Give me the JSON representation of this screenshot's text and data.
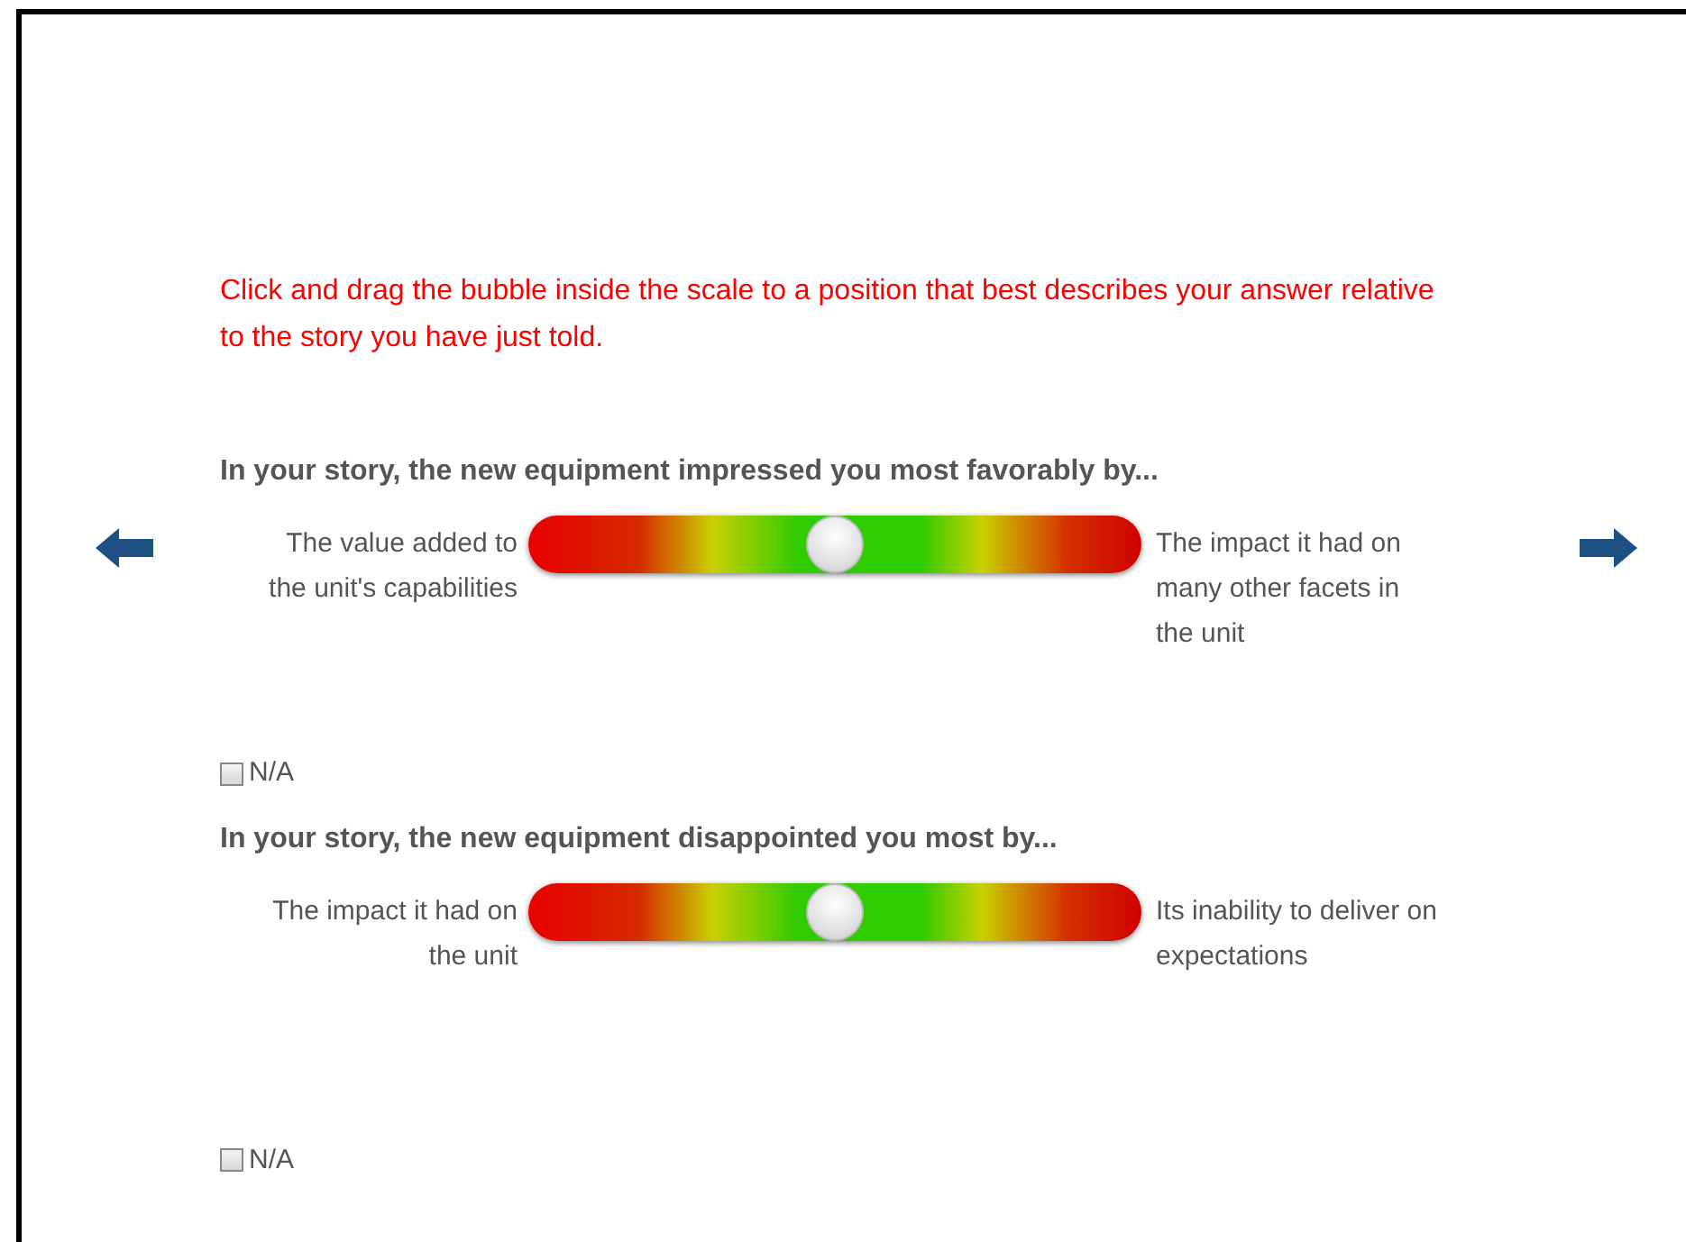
{
  "instruction": "Click and drag the bubble inside the scale to a position that best describes your answer relative to the story you have just told.",
  "questions": [
    {
      "prompt": "In your story, the new equipment impressed you most favorably by...",
      "left_label": "The value added to the unit's capabilities",
      "right_label": "The impact it had on many other facets in the unit",
      "level": 0.5,
      "na": {
        "label": "N/A",
        "checked": false
      }
    },
    {
      "prompt": "In your story, the new equipment disappointed you most by...",
      "left_label": "The impact it had on the unit",
      "right_label": "Its inability to deliver on expectations",
      "level": 0.5,
      "na": {
        "label": "N/A",
        "checked": false
      }
    }
  ]
}
